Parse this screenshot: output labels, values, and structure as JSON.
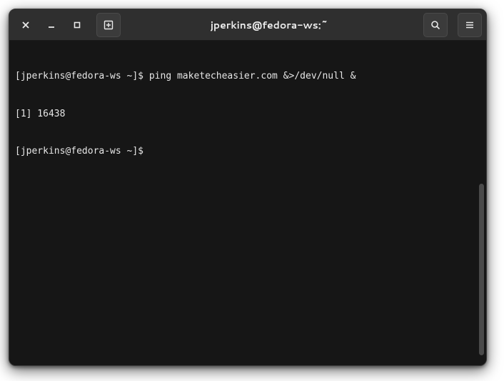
{
  "window": {
    "title": "jperkins@fedora-ws:~"
  },
  "terminal": {
    "lines": [
      {
        "prompt": "[jperkins@fedora-ws ~]$ ",
        "command": "ping maketecheasier.com &>/dev/null &"
      },
      {
        "output": "[1] 16438"
      },
      {
        "prompt": "[jperkins@fedora-ws ~]$ ",
        "command": ""
      }
    ]
  }
}
